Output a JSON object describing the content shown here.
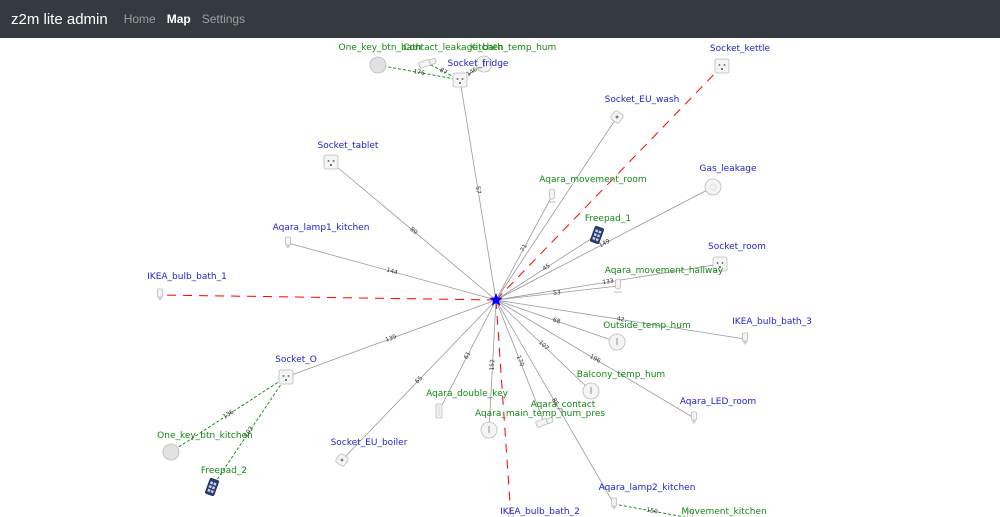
{
  "app": {
    "title": "z2m lite admin"
  },
  "nav": {
    "items": [
      {
        "label": "Home",
        "active": false
      },
      {
        "label": "Map",
        "active": true
      },
      {
        "label": "Settings",
        "active": false
      }
    ]
  },
  "colors": {
    "navbar_bg": "#343a40",
    "router_label": "#2222cc",
    "end_device_label": "#118811",
    "coordinator": "#0000ff",
    "link": "#999999",
    "route_link": "#ff0000",
    "child_link": "#008800"
  },
  "map": {
    "coordinator": {
      "name": "coordinator",
      "icon": "star-icon"
    },
    "nodes": [
      {
        "id": "one_key_btn_bath",
        "name": "One_key_btn_bath",
        "type": "end",
        "icon": "round-button-icon"
      },
      {
        "id": "contact_leakage",
        "name": "Contact_leakage_bath",
        "type": "end",
        "icon": "contact-sensor-icon"
      },
      {
        "id": "kitchen_temp_hum",
        "name": "Kitchen_temp_hum",
        "type": "end",
        "icon": "temp-sensor-icon"
      },
      {
        "id": "socket_fridge",
        "name": "Socket_fridge",
        "type": "router",
        "icon": "socket-icon"
      },
      {
        "id": "socket_kettle",
        "name": "Socket_kettle",
        "type": "router",
        "icon": "socket-icon"
      },
      {
        "id": "socket_eu_wash",
        "name": "Socket_EU_wash",
        "type": "router",
        "icon": "plug-icon"
      },
      {
        "id": "socket_tablet",
        "name": "Socket_tablet",
        "type": "router",
        "icon": "socket-icon"
      },
      {
        "id": "gas_leakage",
        "name": "Gas_leakage",
        "type": "router",
        "icon": "gas-sensor-icon"
      },
      {
        "id": "aqara_movement_room",
        "name": "Aqara_movement_room",
        "type": "end",
        "icon": "motion-sensor-icon"
      },
      {
        "id": "freepad_1",
        "name": "Freepad_1",
        "type": "end",
        "icon": "keypad-icon"
      },
      {
        "id": "aqara_lamp1_kitchen",
        "name": "Aqara_lamp1_kitchen",
        "type": "router",
        "icon": "bulb-icon"
      },
      {
        "id": "socket_room",
        "name": "Socket_room",
        "type": "router",
        "icon": "socket-icon"
      },
      {
        "id": "aqara_movement_hallway",
        "name": "Aqara_movement_hallway",
        "type": "end",
        "icon": "motion-sensor-icon"
      },
      {
        "id": "ikea_bulb_bath_1",
        "name": "IKEA_bulb_bath_1",
        "type": "router",
        "icon": "bulb-icon"
      },
      {
        "id": "outside_temp_hum",
        "name": "Outside_temp_hum",
        "type": "end",
        "icon": "temp-sensor-icon"
      },
      {
        "id": "ikea_bulb_bath_3",
        "name": "IKEA_bulb_bath_3",
        "type": "router",
        "icon": "bulb-icon"
      },
      {
        "id": "socket_o",
        "name": "Socket_O",
        "type": "router",
        "icon": "socket-icon"
      },
      {
        "id": "balcony_temp_hum",
        "name": "Balcony_temp_hum",
        "type": "end",
        "icon": "temp-sensor-icon"
      },
      {
        "id": "aqara_double_key",
        "name": "Aqara_double_key",
        "type": "end",
        "icon": "wall-switch-icon"
      },
      {
        "id": "aqara_contact",
        "name": "Aqara_contact",
        "type": "end",
        "icon": "contact-sensor-icon"
      },
      {
        "id": "aqara_main_temp_hum_pres",
        "name": "Aqara_main_temp_hum_pres",
        "type": "end",
        "icon": "temp-sensor-icon"
      },
      {
        "id": "aqara_led_room",
        "name": "Aqara_LED_room",
        "type": "router",
        "icon": "bulb-icon"
      },
      {
        "id": "one_key_btn_kitchen",
        "name": "One_key_btn_kitchen",
        "type": "end",
        "icon": "round-button-icon"
      },
      {
        "id": "socket_eu_boiler",
        "name": "Socket_EU_boiler",
        "type": "router",
        "icon": "plug-icon"
      },
      {
        "id": "freepad_2",
        "name": "Freepad_2",
        "type": "end",
        "icon": "keypad-icon"
      },
      {
        "id": "aqara_lamp2_kitchen",
        "name": "Aqara_lamp2_kitchen",
        "type": "router",
        "icon": "bulb-icon"
      },
      {
        "id": "ikea_bulb_bath_2",
        "name": "IKEA_bulb_bath_2",
        "type": "router",
        "icon": "bulb-icon"
      },
      {
        "id": "movement_kitchen",
        "name": "Movement_kitchen",
        "type": "end",
        "icon": "motion-sensor-icon"
      }
    ],
    "links": [
      {
        "from": "coordinator",
        "to": "socket_fridge",
        "lqi": "57",
        "style": "solid"
      },
      {
        "from": "coordinator",
        "to": "socket_kettle",
        "lqi": "",
        "style": "route"
      },
      {
        "from": "coordinator",
        "to": "socket_eu_wash",
        "lqi": "",
        "style": "solid"
      },
      {
        "from": "coordinator",
        "to": "socket_tablet",
        "lqi": "89",
        "style": "solid"
      },
      {
        "from": "coordinator",
        "to": "gas_leakage",
        "lqi": "149",
        "style": "solid"
      },
      {
        "from": "coordinator",
        "to": "aqara_movement_room",
        "lqi": "71",
        "style": "solid"
      },
      {
        "from": "coordinator",
        "to": "freepad_1",
        "lqi": "45",
        "style": "solid"
      },
      {
        "from": "coordinator",
        "to": "aqara_lamp1_kitchen",
        "lqi": "144",
        "style": "solid"
      },
      {
        "from": "coordinator",
        "to": "socket_room",
        "lqi": "133",
        "style": "solid"
      },
      {
        "from": "coordinator",
        "to": "aqara_movement_hallway",
        "lqi": "53",
        "style": "solid"
      },
      {
        "from": "coordinator",
        "to": "ikea_bulb_bath_1",
        "lqi": "",
        "style": "route"
      },
      {
        "from": "coordinator",
        "to": "outside_temp_hum",
        "lqi": "68",
        "style": "solid"
      },
      {
        "from": "coordinator",
        "to": "ikea_bulb_bath_3",
        "lqi": "42",
        "style": "solid"
      },
      {
        "from": "coordinator",
        "to": "socket_o",
        "lqi": "139",
        "style": "solid"
      },
      {
        "from": "coordinator",
        "to": "balcony_temp_hum",
        "lqi": "107",
        "style": "solid"
      },
      {
        "from": "coordinator",
        "to": "aqara_double_key",
        "lqi": "61",
        "style": "solid"
      },
      {
        "from": "coordinator",
        "to": "aqara_contact",
        "lqi": "170",
        "style": "solid"
      },
      {
        "from": "coordinator",
        "to": "aqara_main_temp_hum_pres",
        "lqi": "152",
        "style": "solid"
      },
      {
        "from": "coordinator",
        "to": "aqara_led_room",
        "lqi": "196",
        "style": "solid"
      },
      {
        "from": "coordinator",
        "to": "socket_eu_boiler",
        "lqi": "65",
        "style": "solid"
      },
      {
        "from": "coordinator",
        "to": "aqara_lamp2_kitchen",
        "lqi": "85",
        "style": "solid"
      },
      {
        "from": "coordinator",
        "to": "ikea_bulb_bath_2",
        "lqi": "",
        "style": "route"
      },
      {
        "from": "socket_fridge",
        "to": "one_key_btn_bath",
        "lqi": "176",
        "style": "child"
      },
      {
        "from": "socket_fridge",
        "to": "contact_leakage",
        "lqi": "87",
        "style": "child"
      },
      {
        "from": "socket_fridge",
        "to": "kitchen_temp_hum",
        "lqi": "145",
        "style": "child"
      },
      {
        "from": "socket_o",
        "to": "one_key_btn_kitchen",
        "lqi": "136",
        "style": "child"
      },
      {
        "from": "socket_o",
        "to": "freepad_2",
        "lqi": "102",
        "style": "child"
      },
      {
        "from": "aqara_lamp2_kitchen",
        "to": "movement_kitchen",
        "lqi": "150",
        "style": "child"
      }
    ]
  }
}
